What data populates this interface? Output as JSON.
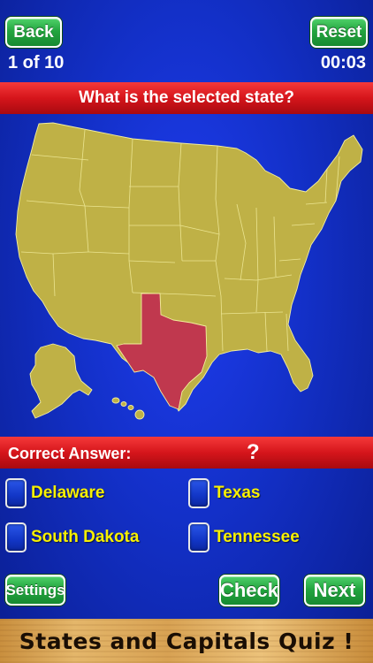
{
  "header": {
    "back_label": "Back",
    "reset_label": "Reset",
    "counter": "1 of 10",
    "timer": "00:03"
  },
  "question": "What is the selected state?",
  "answer": {
    "label": "Correct Answer:",
    "value": "?"
  },
  "map": {
    "land_color": "#bfb146",
    "selected_state_color": "#c0384e",
    "border_color": "#f3ee9e",
    "selected_state": "Texas"
  },
  "options": [
    {
      "label": "Delaware"
    },
    {
      "label": "Texas"
    },
    {
      "label": "South Dakota"
    },
    {
      "label": "Tennessee"
    }
  ],
  "footer": {
    "settings_label": "Settings",
    "check_label": "Check",
    "next_label": "Next",
    "app_title": "States and Capitals Quiz !"
  }
}
